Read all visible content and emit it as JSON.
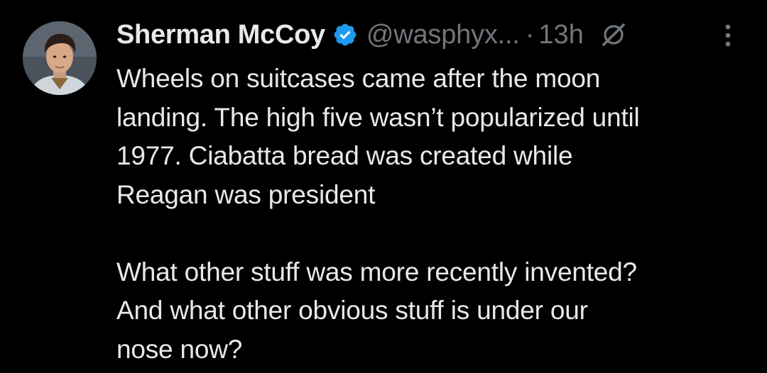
{
  "tweet": {
    "author_name": "Sherman McCoy",
    "handle": "@wasphyx...",
    "separator": "·",
    "time": "13h",
    "paragraph_1": [
      "Wheels on suitcases came after the moon",
      "landing. The high five wasn’t popularized until",
      "1977. Ciabatta bread was created while",
      "Reagan was president"
    ],
    "paragraph_2": [
      "What other stuff was more recently invented?",
      "And what other obvious stuff is under our",
      "nose now?"
    ]
  },
  "icons": {
    "verified": "verified-badge-icon",
    "grok": "grok-icon",
    "more": "more-options-icon"
  },
  "colors": {
    "background": "#000000",
    "primary_text": "#e7e9ea",
    "secondary_text": "#71767b",
    "verified_blue": "#1d9bf0"
  }
}
